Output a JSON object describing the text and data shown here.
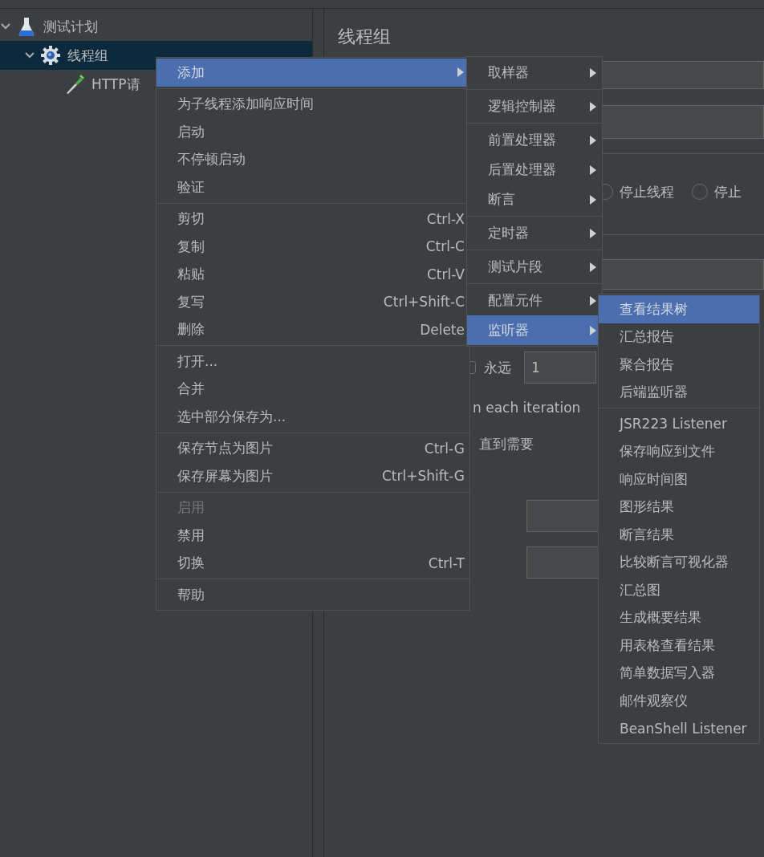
{
  "tree": [
    {
      "label": "测试计划",
      "kind": "test-plan",
      "expanded": true,
      "selected": false,
      "children": [
        {
          "label": "线程组",
          "kind": "thread-group",
          "expanded": true,
          "selected": true,
          "children": [
            {
              "label": "HTTP请",
              "kind": "sampler",
              "selected": false
            }
          ]
        }
      ]
    }
  ],
  "panel": {
    "title": "线程组",
    "radios": [
      {
        "label": "停止线程",
        "selected": false
      },
      {
        "label": "停止",
        "selected": false
      }
    ],
    "loop": {
      "checked": false,
      "label": "永远",
      "value": "1"
    },
    "notes": [
      "n each iteration",
      "直到需要"
    ]
  },
  "context_menu": {
    "groups": [
      [
        {
          "label": "添加",
          "submenu": true,
          "selected": true,
          "disabled": false
        }
      ],
      [
        {
          "label": "为子线程添加响应时间",
          "selected": false,
          "disabled": false
        },
        {
          "label": "启动",
          "selected": false,
          "disabled": false
        },
        {
          "label": "不停顿启动",
          "selected": false,
          "disabled": false
        },
        {
          "label": "验证",
          "selected": false,
          "disabled": false
        }
      ],
      [
        {
          "label": "剪切",
          "shortcut": "Ctrl-X",
          "selected": false,
          "disabled": false
        },
        {
          "label": "复制",
          "shortcut": "Ctrl-C",
          "selected": false,
          "disabled": false
        },
        {
          "label": "粘贴",
          "shortcut": "Ctrl-V",
          "selected": false,
          "disabled": false
        },
        {
          "label": "复写",
          "shortcut": "Ctrl+Shift-C",
          "selected": false,
          "disabled": false
        },
        {
          "label": "删除",
          "shortcut": "Delete",
          "selected": false,
          "disabled": false
        }
      ],
      [
        {
          "label": "打开...",
          "selected": false,
          "disabled": false
        },
        {
          "label": "合并",
          "selected": false,
          "disabled": false
        },
        {
          "label": "选中部分保存为...",
          "selected": false,
          "disabled": false
        }
      ],
      [
        {
          "label": "保存节点为图片",
          "shortcut": "Ctrl-G",
          "selected": false,
          "disabled": false
        },
        {
          "label": "保存屏幕为图片",
          "shortcut": "Ctrl+Shift-G",
          "selected": false,
          "disabled": false
        }
      ],
      [
        {
          "label": "启用",
          "selected": false,
          "disabled": true
        },
        {
          "label": "禁用",
          "selected": false,
          "disabled": false
        },
        {
          "label": "切换",
          "shortcut": "Ctrl-T",
          "selected": false,
          "disabled": false
        }
      ],
      [
        {
          "label": "帮助",
          "selected": false,
          "disabled": false
        }
      ]
    ]
  },
  "add_menu": {
    "groups": [
      [
        {
          "label": "取样器",
          "submenu": true,
          "selected": false
        }
      ],
      [
        {
          "label": "逻辑控制器",
          "submenu": true,
          "selected": false
        }
      ],
      [
        {
          "label": "前置处理器",
          "submenu": true,
          "selected": false
        },
        {
          "label": "后置处理器",
          "submenu": true,
          "selected": false
        },
        {
          "label": "断言",
          "submenu": true,
          "selected": false
        }
      ],
      [
        {
          "label": "定时器",
          "submenu": true,
          "selected": false
        }
      ],
      [
        {
          "label": "测试片段",
          "submenu": true,
          "selected": false
        }
      ],
      [
        {
          "label": "配置元件",
          "submenu": true,
          "selected": false
        },
        {
          "label": "监听器",
          "submenu": true,
          "selected": true
        }
      ]
    ]
  },
  "listener_menu": {
    "groups": [
      [
        {
          "label": "查看结果树",
          "selected": true
        },
        {
          "label": "汇总报告",
          "selected": false
        },
        {
          "label": "聚合报告",
          "selected": false
        },
        {
          "label": "后端监听器",
          "selected": false
        }
      ],
      [
        {
          "label": "JSR223 Listener",
          "selected": false
        },
        {
          "label": "保存响应到文件",
          "selected": false
        },
        {
          "label": "响应时间图",
          "selected": false
        },
        {
          "label": "图形结果",
          "selected": false
        },
        {
          "label": "断言结果",
          "selected": false
        },
        {
          "label": "比较断言可视化器",
          "selected": false
        },
        {
          "label": "汇总图",
          "selected": false
        },
        {
          "label": "生成概要结果",
          "selected": false
        },
        {
          "label": "用表格查看结果",
          "selected": false
        },
        {
          "label": "简单数据写入器",
          "selected": false
        },
        {
          "label": "邮件观察仪",
          "selected": false
        },
        {
          "label": "BeanShell Listener",
          "selected": false
        }
      ]
    ]
  }
}
